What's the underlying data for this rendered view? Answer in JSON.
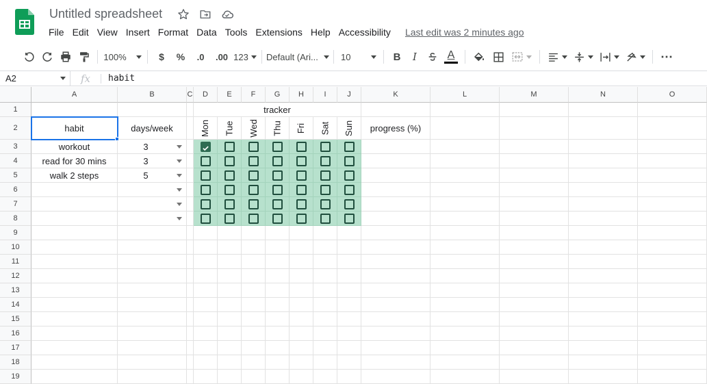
{
  "app": {
    "doc_title": "Untitled spreadsheet",
    "menus": [
      "File",
      "Edit",
      "View",
      "Insert",
      "Format",
      "Data",
      "Tools",
      "Extensions",
      "Help",
      "Accessibility"
    ],
    "last_edit": "Last edit was 2 minutes ago"
  },
  "toolbar": {
    "zoom": "100%",
    "currency": "$",
    "percent": "%",
    "decrease_decimal": ".0",
    "increase_decimal": ".00",
    "number_format": "123",
    "font": "Default (Ari...",
    "font_size": "10",
    "bold": "B",
    "italic": "I",
    "text_color": "A",
    "more": "⋯"
  },
  "formula_bar": {
    "name_box": "A2",
    "fx": "fx",
    "value": "habit"
  },
  "columns": [
    "A",
    "B",
    "C",
    "D",
    "E",
    "F",
    "G",
    "H",
    "I",
    "J",
    "K",
    "L",
    "M",
    "N",
    "O"
  ],
  "rows": [
    "1",
    "2",
    "3",
    "4",
    "5",
    "6",
    "7",
    "8",
    "9",
    "10",
    "11",
    "12",
    "13",
    "14",
    "15",
    "16",
    "17",
    "18",
    "19"
  ],
  "sheet": {
    "tracker_title": "tracker",
    "habit_header": "habit",
    "days_header": "days/week",
    "progress_header": "progress (%)",
    "weekdays": [
      "Mon",
      "Tue",
      "Wed",
      "Thu",
      "Fri",
      "Sat",
      "Sun"
    ],
    "habits": [
      {
        "name": "workout",
        "days": "3"
      },
      {
        "name": "read for 30 mins",
        "days": "3"
      },
      {
        "name": "walk 2 steps",
        "days": "5"
      },
      {
        "name": "",
        "days": ""
      },
      {
        "name": "",
        "days": ""
      },
      {
        "name": "",
        "days": ""
      }
    ],
    "checked": [
      [
        true,
        false,
        false,
        false,
        false,
        false,
        false
      ],
      [
        false,
        false,
        false,
        false,
        false,
        false,
        false
      ],
      [
        false,
        false,
        false,
        false,
        false,
        false,
        false
      ],
      [
        false,
        false,
        false,
        false,
        false,
        false,
        false
      ],
      [
        false,
        false,
        false,
        false,
        false,
        false,
        false
      ],
      [
        false,
        false,
        false,
        false,
        false,
        false,
        false
      ]
    ]
  },
  "colors": {
    "tracker_fill": "#b7e1cd",
    "checkbox": "#1f4e3d",
    "selection": "#1a73e8",
    "sheets_green": "#0f9d58"
  }
}
